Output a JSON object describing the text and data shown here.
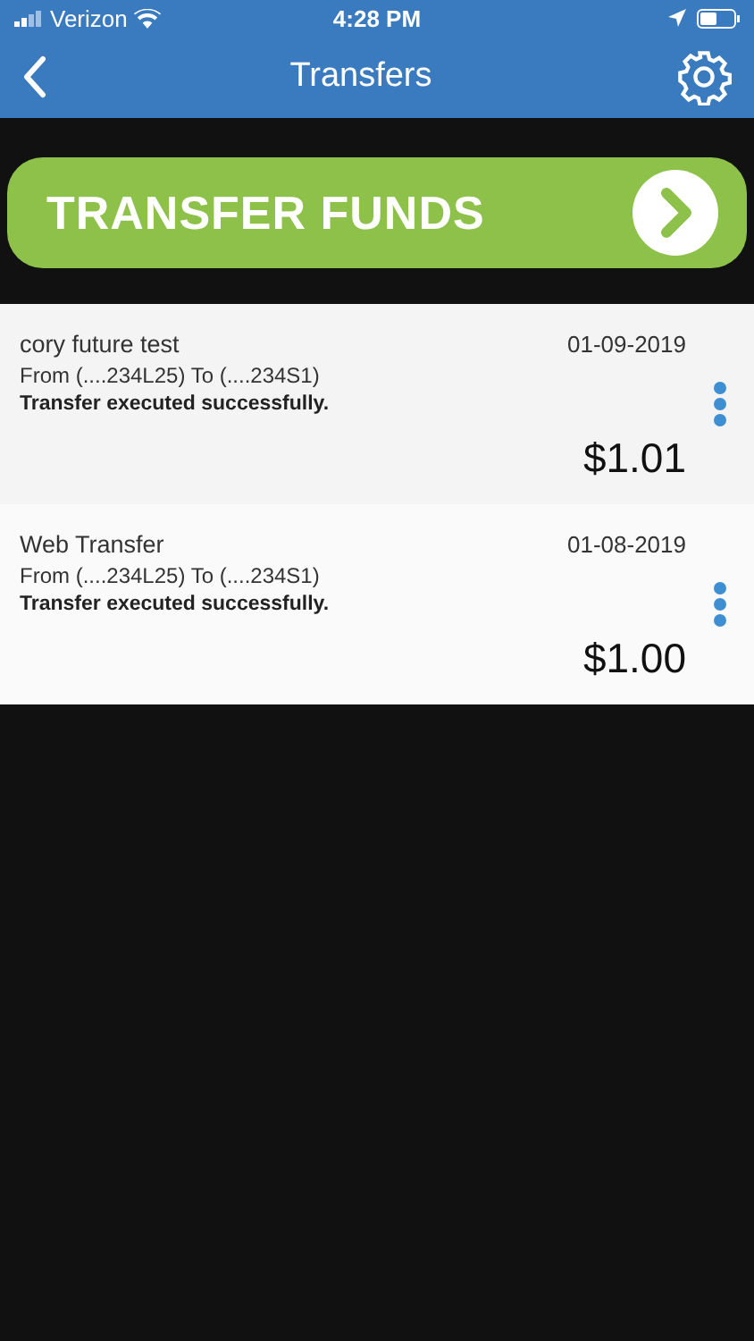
{
  "status_bar": {
    "carrier": "Verizon",
    "time": "4:28 PM"
  },
  "nav": {
    "title": "Transfers"
  },
  "transfer_button": {
    "label": "TRANSFER FUNDS"
  },
  "transfers": [
    {
      "name": "cory future test",
      "date": "01-09-2019",
      "accounts": "From (....234L25) To (....234S1)",
      "status": "Transfer executed successfully.",
      "amount": "$1.01"
    },
    {
      "name": "Web Transfer",
      "date": "01-08-2019",
      "accounts": "From (....234L25) To (....234S1)",
      "status": "Transfer executed successfully.",
      "amount": "$1.00"
    }
  ]
}
